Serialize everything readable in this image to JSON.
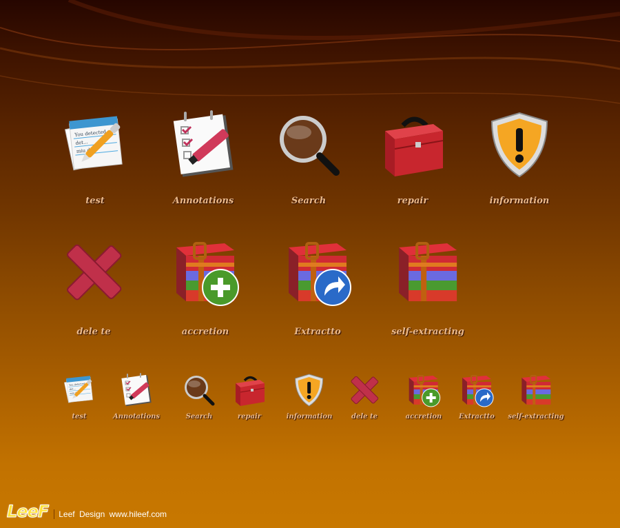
{
  "large_row_1": [
    {
      "icon": "notepad-pen-icon",
      "label": "test"
    },
    {
      "icon": "checklist-marker-icon",
      "label": "Annotations"
    },
    {
      "icon": "magnifier-icon",
      "label": "Search"
    },
    {
      "icon": "toolbox-icon",
      "label": "repair"
    },
    {
      "icon": "warning-shield-icon",
      "label": "information"
    }
  ],
  "large_row_2": [
    {
      "icon": "red-x-icon",
      "label": "dele te"
    },
    {
      "icon": "archive-add-icon",
      "label": "accretion"
    },
    {
      "icon": "archive-extract-icon",
      "label": "Extractto"
    },
    {
      "icon": "archive-icon",
      "label": "self-extracting"
    }
  ],
  "small_row": [
    {
      "icon": "notepad-pen-icon",
      "label": "test"
    },
    {
      "icon": "checklist-marker-icon",
      "label": "Annotations"
    },
    {
      "icon": "magnifier-icon",
      "label": "Search"
    },
    {
      "icon": "toolbox-icon",
      "label": "repair"
    },
    {
      "icon": "warning-shield-icon",
      "label": "information"
    },
    {
      "icon": "red-x-icon",
      "label": "dele te"
    },
    {
      "icon": "archive-add-icon",
      "label": "accretion"
    },
    {
      "icon": "archive-extract-icon",
      "label": "Extractto"
    },
    {
      "icon": "archive-icon",
      "label": "self-extracting"
    }
  ],
  "notepad_text": [
    "You detected",
    "det...",
    "miu de..."
  ],
  "footer": {
    "logo": "LeeF",
    "text": "Leef  Design  www.hileef.com"
  },
  "colors": {
    "label": "#eab98c",
    "background_top": "#260600",
    "background_bottom": "#c87800"
  }
}
